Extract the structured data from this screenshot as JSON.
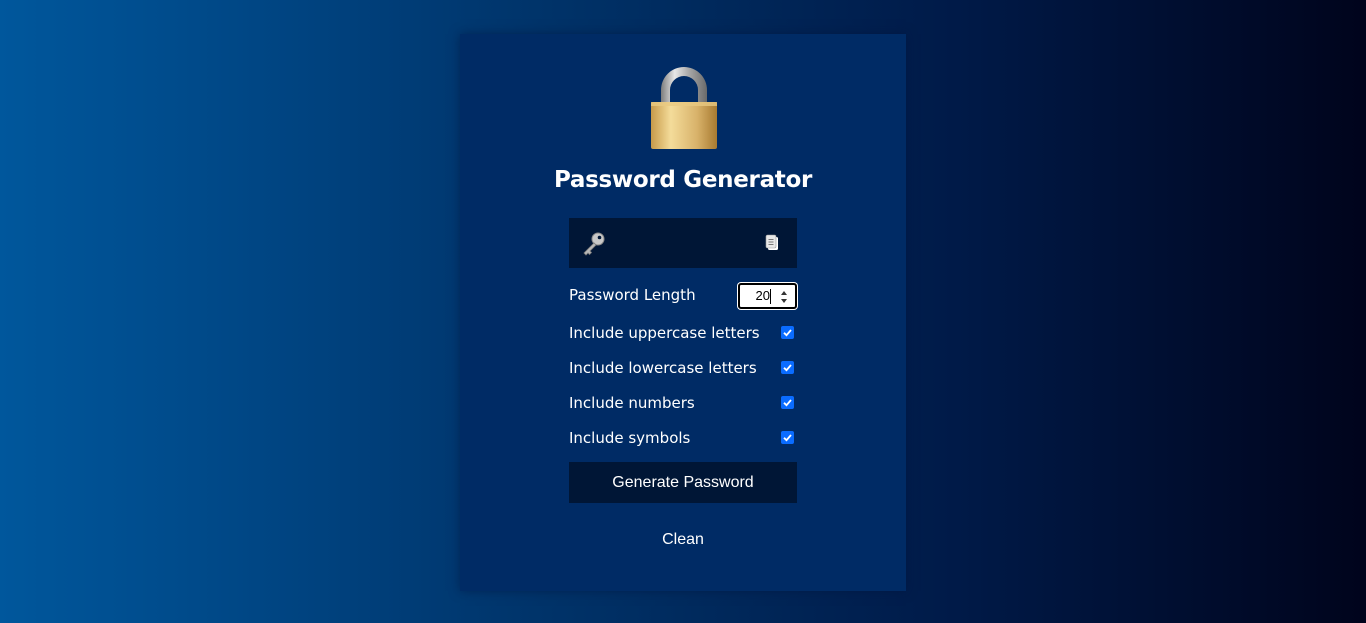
{
  "app": {
    "title": "Password Generator"
  },
  "password_field": {
    "value": "",
    "key_icon": "key-icon",
    "copy_icon": "clipboard-icon"
  },
  "options": {
    "length_label": "Password Length",
    "length_value": "20",
    "checkboxes": [
      {
        "label": "Include uppercase letters",
        "checked": true
      },
      {
        "label": "Include lowercase letters",
        "checked": true
      },
      {
        "label": "Include numbers",
        "checked": true
      },
      {
        "label": "Include symbols",
        "checked": true
      }
    ]
  },
  "buttons": {
    "generate_label": "Generate Password",
    "clean_label": "Clean"
  },
  "colors": {
    "card_bg": "#002b65",
    "field_bg": "#001636",
    "checkbox_accent": "#0a6cff"
  }
}
